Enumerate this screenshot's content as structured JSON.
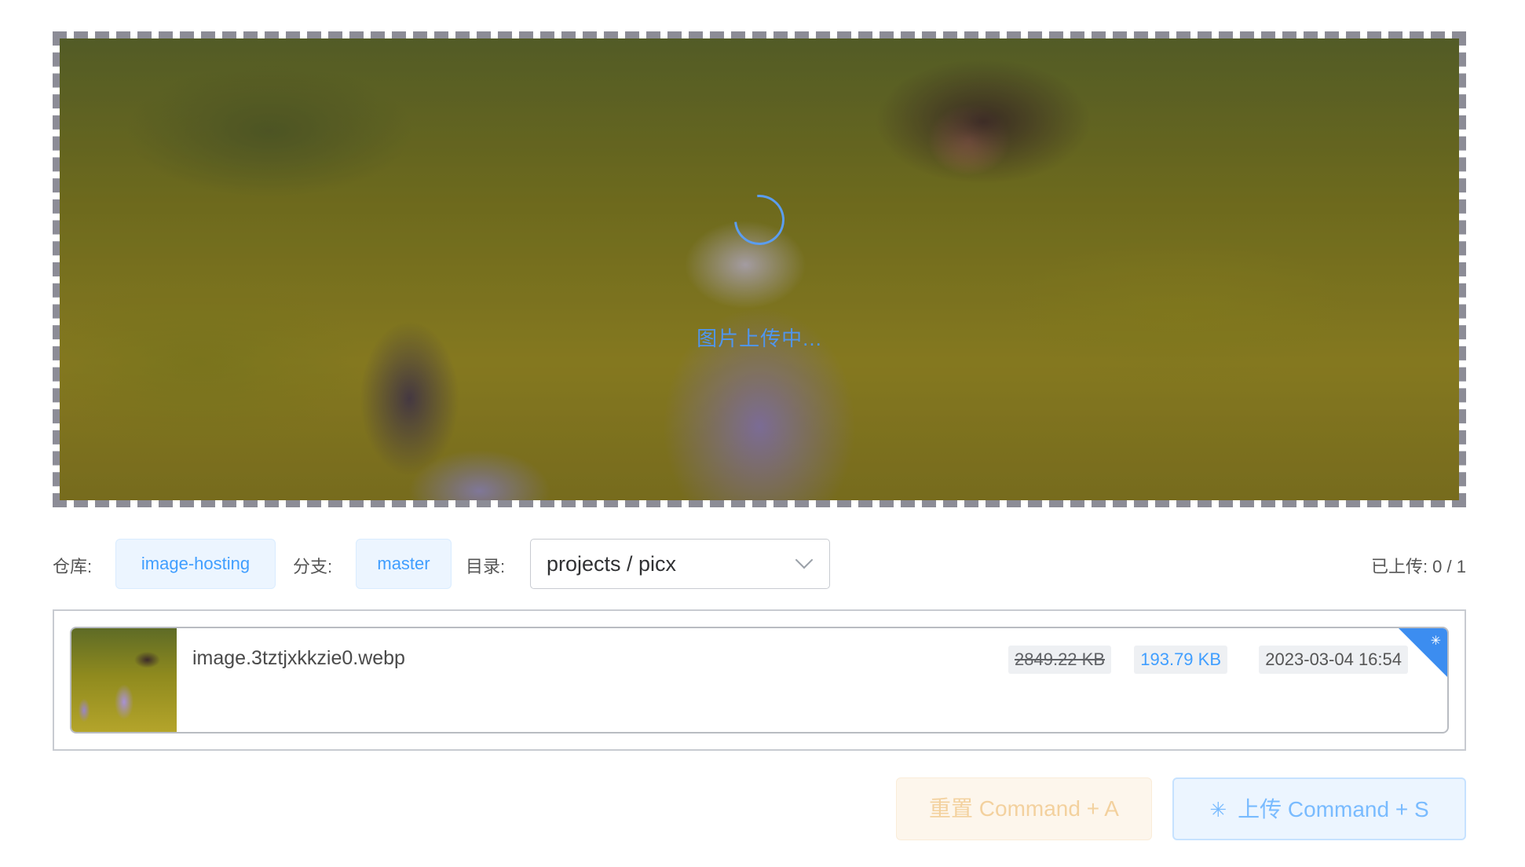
{
  "upload_area": {
    "loading_text": "图片上传中..."
  },
  "config": {
    "repo_label": "仓库:",
    "repo_value": "image-hosting",
    "branch_label": "分支:",
    "branch_value": "master",
    "dir_label": "目录:",
    "dir_value": "projects / picx",
    "uploaded_info": "已上传: 0 / 1"
  },
  "file_list": {
    "items": [
      {
        "name": "image.3tztjxkkzie0.webp",
        "original_size": "2849.22 KB",
        "compressed_size": "193.79 KB",
        "date": "2023-03-04 16:54",
        "status_icon": "loading-icon"
      }
    ]
  },
  "actions": {
    "reset_label": "重置 Command + A",
    "upload_label": "上传 Command + S",
    "upload_icon": "loading-icon"
  },
  "colors": {
    "accent": "#409eff",
    "warning_light": "#fdf6ec",
    "badge": "#3c8df0"
  }
}
